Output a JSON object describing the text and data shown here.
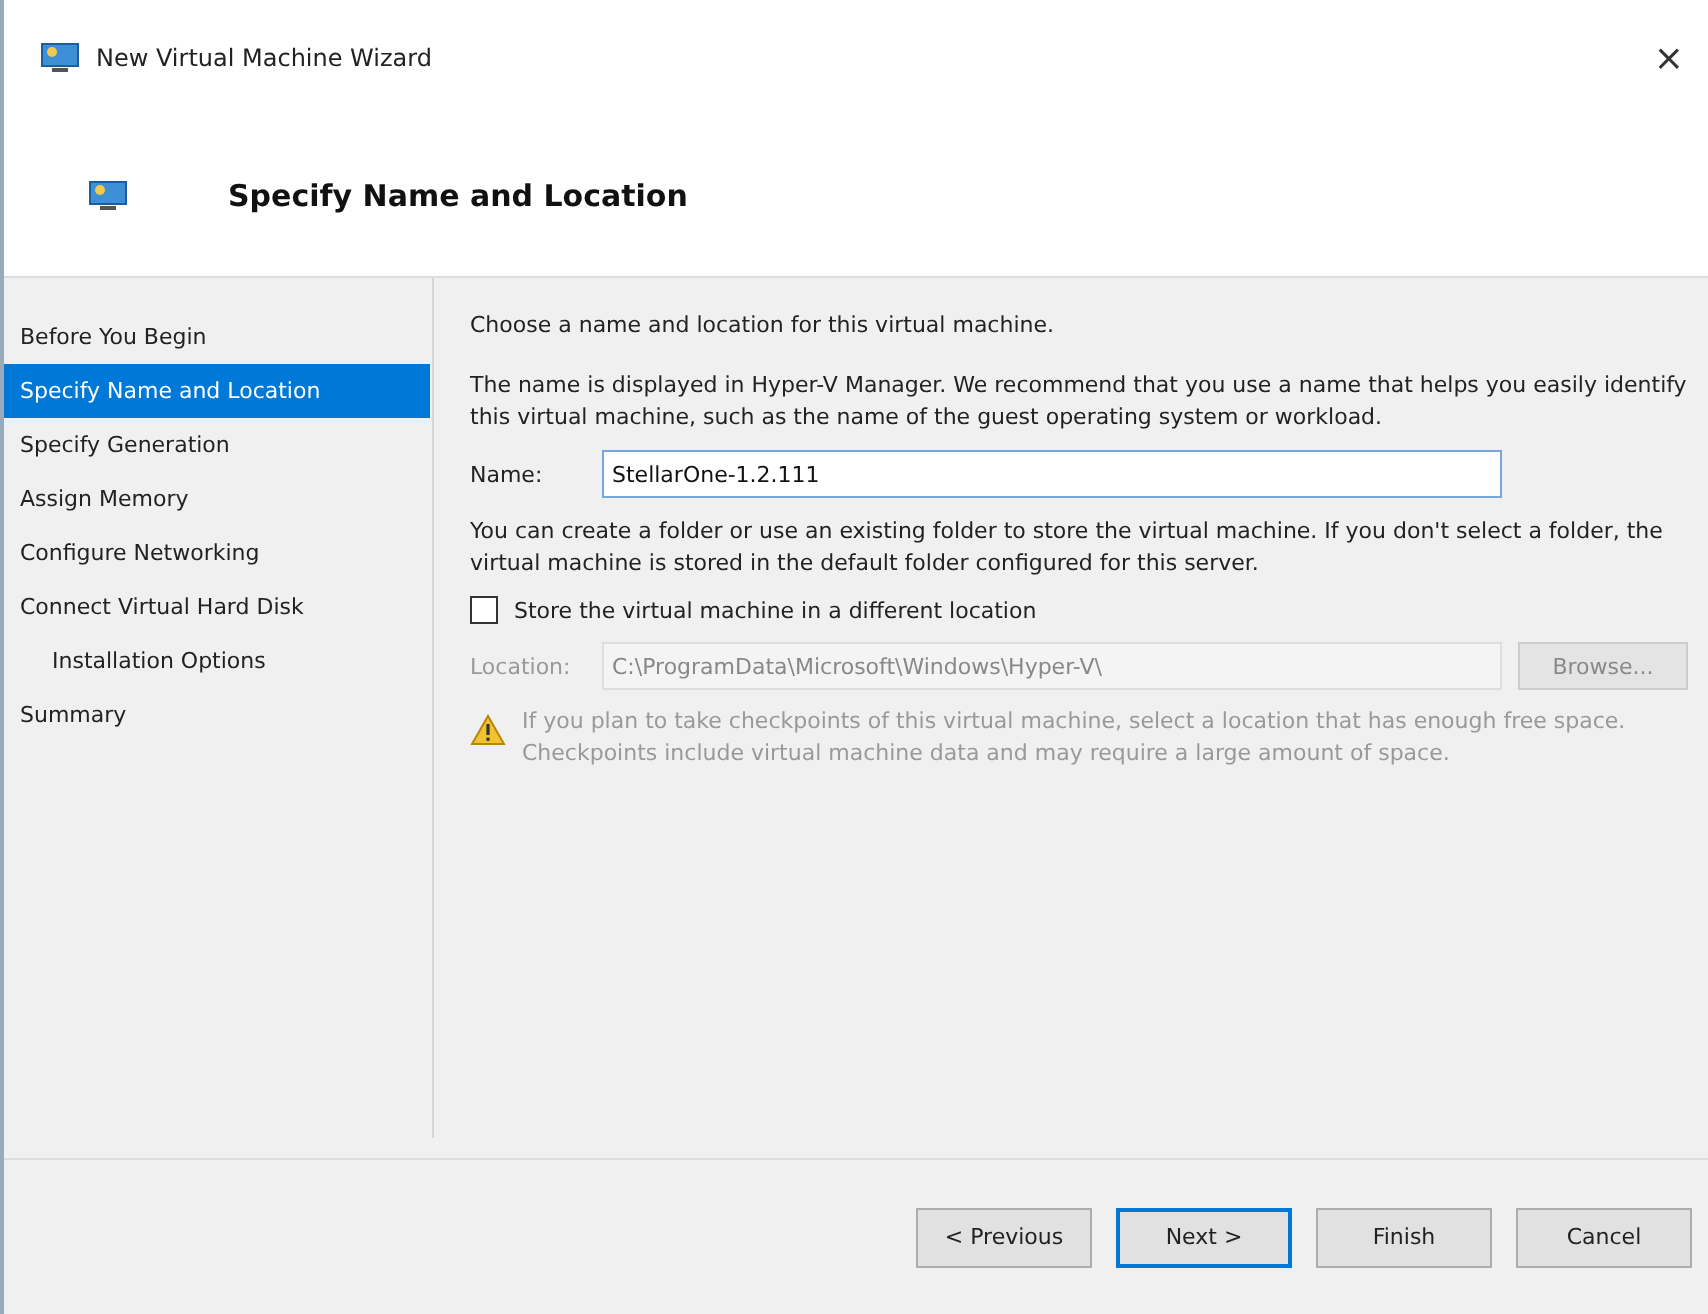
{
  "window": {
    "title": "New Virtual Machine Wizard",
    "close": "×"
  },
  "header": {
    "title": "Specify Name and Location"
  },
  "steps": [
    {
      "label": "Before You Begin",
      "selected": false
    },
    {
      "label": "Specify Name and Location",
      "selected": true
    },
    {
      "label": "Specify Generation",
      "selected": false
    },
    {
      "label": "Assign Memory",
      "selected": false
    },
    {
      "label": "Configure Networking",
      "selected": false
    },
    {
      "label": "Connect Virtual Hard Disk",
      "selected": false,
      "children": [
        {
          "label": "Installation Options",
          "selected": false
        }
      ]
    },
    {
      "label": "Summary",
      "selected": false
    }
  ],
  "content": {
    "intro": "Choose a name and location for this virtual machine.",
    "name_help": "The name is displayed in Hyper-V Manager. We recommend that you use a name that helps you easily identify this virtual machine, such as the name of the guest operating system or workload.",
    "name_label": "Name:",
    "name_value": "StellarOne-1.2.111",
    "folder_help": "You can create a folder or use an existing folder to store the virtual machine. If you don't select a folder, the virtual machine is stored in the default folder configured for this server.",
    "store_checkbox": {
      "label": "Store the virtual machine in a different location",
      "checked": false
    },
    "location": {
      "label": "Location:",
      "value": "C:\\ProgramData\\Microsoft\\Windows\\Hyper-V\\",
      "browse": "Browse...",
      "disabled": true
    },
    "warning": "If you plan to take checkpoints of this virtual machine, select a location that has enough free space. Checkpoints include virtual machine data and may require a large amount of space."
  },
  "buttons": [
    {
      "label": "< Previous",
      "default": false
    },
    {
      "label": "Next >",
      "default": true
    },
    {
      "label": "Finish",
      "default": false
    },
    {
      "label": "Cancel",
      "default": false
    }
  ]
}
